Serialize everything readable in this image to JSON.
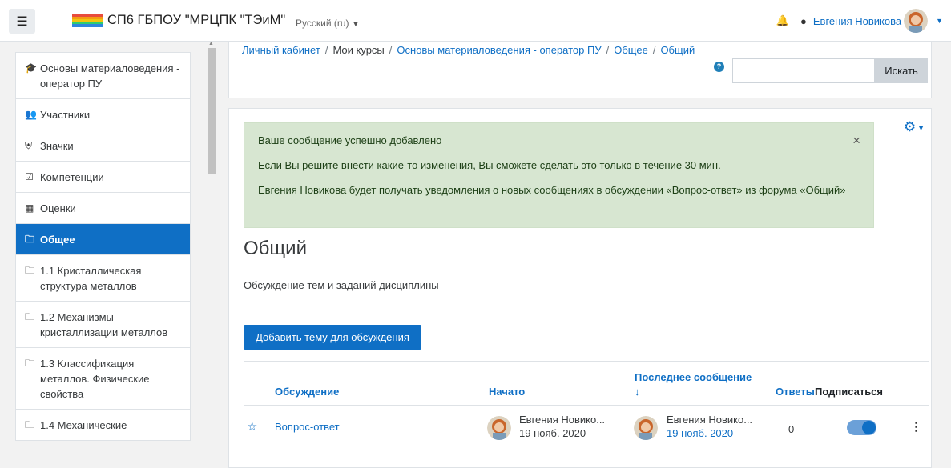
{
  "header": {
    "site_name": "СП6 ГБПОУ \"МРЦПК \"ТЭиМ\"",
    "language": "Русский (ru)",
    "user_name": "Евгения Новикова"
  },
  "sidebar": {
    "items": [
      {
        "label": "Основы материаловедения - оператор ПУ",
        "icon": "graduation-cap-icon"
      },
      {
        "label": "Участники",
        "icon": "users-icon"
      },
      {
        "label": "Значки",
        "icon": "shield-icon"
      },
      {
        "label": "Компетенции",
        "icon": "checkbox-icon"
      },
      {
        "label": "Оценки",
        "icon": "table-icon"
      },
      {
        "label": "Общее",
        "icon": "folder-icon",
        "active": true
      },
      {
        "label": "1.1 Кристаллическая структура металлов",
        "icon": "folder-icon"
      },
      {
        "label": "1.2 Механизмы кристаллизации металлов",
        "icon": "folder-icon"
      },
      {
        "label": "1.3 Классификация металлов. Физические свойства",
        "icon": "folder-icon"
      },
      {
        "label": "1.4 Механические",
        "icon": "folder-icon"
      }
    ]
  },
  "breadcrumb": {
    "items": [
      "Личный кабинет",
      "Мои курсы",
      "Основы материаловедения - оператор ПУ",
      "Общее",
      "Общий"
    ]
  },
  "search": {
    "placeholder": "",
    "button_label": "Искать"
  },
  "alert": {
    "line1": "Ваше сообщение успешно добавлено",
    "line2": "Если Вы решите внести какие-то изменения, Вы сможете сделать это только в течение 30 мин.",
    "line3": "Евгения Новикова будет получать уведомления о новых сообщениях в обсуждении «Вопрос-ответ» из форума «Общий»",
    "close": "×"
  },
  "forum": {
    "title": "Общий",
    "description": "Обсуждение тем и заданий дисциплины",
    "add_button": "Добавить тему для обсуждения"
  },
  "table": {
    "headers": {
      "discussion": "Обсуждение",
      "started": "Начато",
      "last_post_line1": "Последнее сообщение",
      "last_post_arrow": "↓",
      "replies": "Ответы",
      "subscribe": "Подписаться"
    },
    "rows": [
      {
        "title": "Вопрос-ответ",
        "started_by": "Евгения Новико...",
        "started_date": "19 нояб. 2020",
        "last_by": "Евгения Новико...",
        "last_date": "19 нояб. 2020",
        "replies": "0",
        "subscribed": true
      }
    ]
  },
  "colors": {
    "primary": "#0f6fc5",
    "alert_bg": "#d7e6d1"
  }
}
